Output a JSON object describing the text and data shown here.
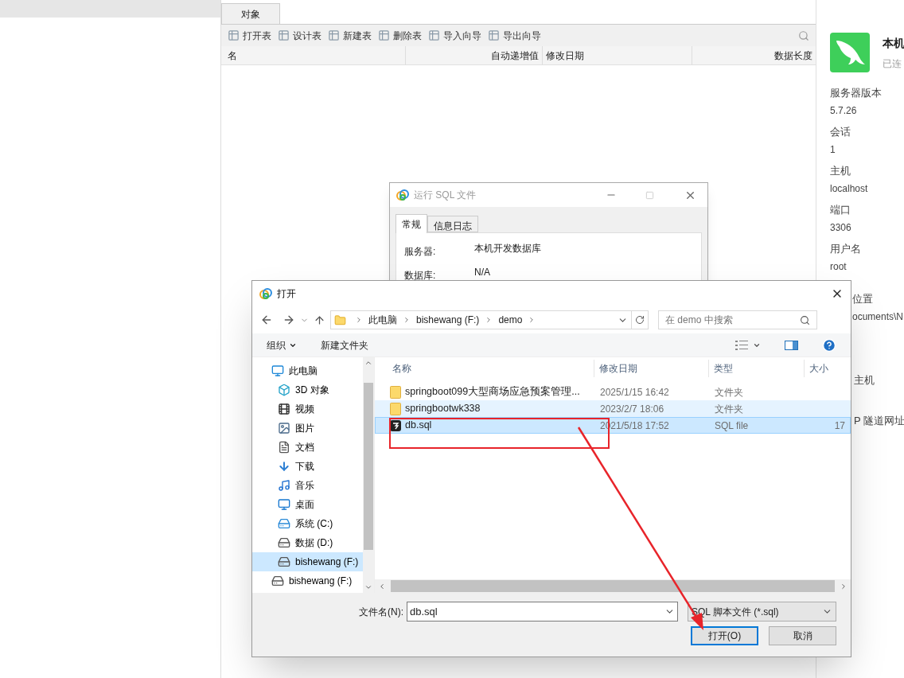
{
  "object_tab": {
    "label": "对象",
    "selected": true
  },
  "toolbar": [
    {
      "label": "打开表"
    },
    {
      "label": "设计表"
    },
    {
      "label": "新建表"
    },
    {
      "label": "删除表"
    },
    {
      "label": "导入向导"
    },
    {
      "label": "导出向导"
    }
  ],
  "columns": [
    {
      "label": "名"
    },
    {
      "label": "自动递增值"
    },
    {
      "label": "修改日期"
    },
    {
      "label": "数据长度"
    }
  ],
  "connection_panel": {
    "name": "本机",
    "status": "已连",
    "fields": [
      {
        "label": "服务器版本",
        "value": "5.7.26"
      },
      {
        "label": "会话",
        "value": "1"
      },
      {
        "label": "主机",
        "value": "localhost"
      },
      {
        "label": "端口",
        "value": "3306"
      },
      {
        "label": "用户名",
        "value": "root"
      }
    ],
    "partial_fields": [
      {
        "label": "位置",
        "value": "ocuments\\N"
      },
      {
        "label": "主机"
      },
      {
        "label": "P 隧道网址"
      }
    ]
  },
  "run_sql_dialog": {
    "title": "运行 SQL 文件",
    "active": false,
    "tabs": [
      {
        "label": "常规",
        "selected": true
      },
      {
        "label": "信息日志",
        "selected": false
      }
    ],
    "fields": [
      {
        "label": "服务器:",
        "value": "本机开发数据库"
      },
      {
        "label": "数据库:",
        "value": "N/A"
      }
    ]
  },
  "open_dialog": {
    "title": "打开",
    "active": true,
    "breadcrumb": [
      "此电脑",
      "bishewang (F:)",
      "demo"
    ],
    "search": {
      "placeholder": "在 demo 中搜索"
    },
    "toolbar": [
      {
        "label": "组织",
        "kind": "menu"
      },
      {
        "label": "新建文件夹",
        "kind": "button"
      }
    ],
    "nav": [
      {
        "label": "此电脑",
        "kind": "computer",
        "selected": false,
        "children": [
          {
            "label": "3D 对象",
            "kind": "cube",
            "selected": false
          },
          {
            "label": "视频",
            "kind": "film",
            "selected": false
          },
          {
            "label": "图片",
            "kind": "picture",
            "selected": false
          },
          {
            "label": "文档",
            "kind": "document",
            "selected": false
          },
          {
            "label": "下载",
            "kind": "download",
            "selected": false
          },
          {
            "label": "音乐",
            "kind": "music",
            "selected": false
          },
          {
            "label": "桌面",
            "kind": "desktop",
            "selected": false
          },
          {
            "label": "系统 (C:)",
            "kind": "systemdrive",
            "selected": false
          },
          {
            "label": "数据 (D:)",
            "kind": "drive",
            "selected": false
          },
          {
            "label": "bishewang (F:)",
            "kind": "drive",
            "selected": true
          }
        ]
      },
      {
        "label": "bishewang (F:)",
        "kind": "drive",
        "selected": false
      }
    ],
    "columns": [
      "名称",
      "修改日期",
      "类型",
      "大小"
    ],
    "files": [
      {
        "name": "springboot099大型商场应急预案管理...",
        "date": "2025/1/15 16:42",
        "type": "文件夹",
        "kind": "folder",
        "selected": false,
        "hovered": false
      },
      {
        "name": "springbootwk338",
        "date": "2023/2/7 18:06",
        "type": "文件夹",
        "kind": "folder",
        "selected": false,
        "hovered": true
      },
      {
        "name": "db.sql",
        "date": "2021/5/18 17:52",
        "type": "SQL file",
        "size": "17",
        "kind": "file",
        "selected": true,
        "hovered": false
      }
    ],
    "file_name": {
      "label": "文件名(N):",
      "value": "db.sql"
    },
    "file_type": {
      "value": "SQL 脚本文件 (*.sql)"
    },
    "buttons": [
      {
        "label": "打开(O)",
        "default": true
      },
      {
        "label": "取消",
        "default": false
      }
    ]
  }
}
